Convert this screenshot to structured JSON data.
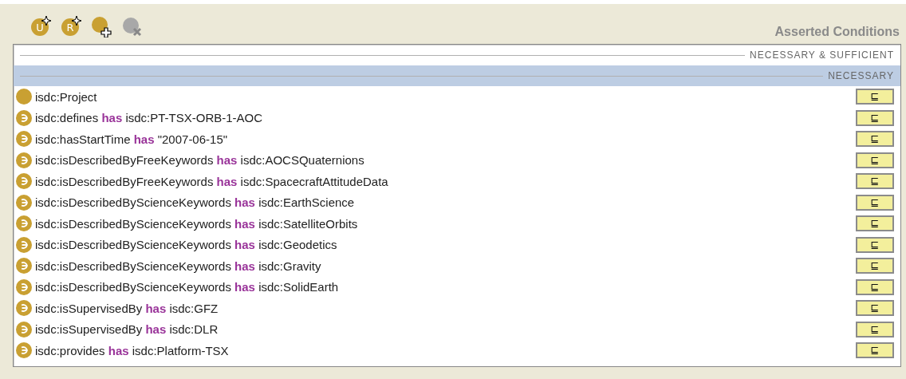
{
  "toolbar": [
    {
      "kind": "new-union",
      "letter": "U",
      "disabled": false
    },
    {
      "kind": "new-restriction",
      "letter": "R",
      "disabled": false
    },
    {
      "kind": "add-class",
      "disabled": false
    },
    {
      "kind": "remove",
      "disabled": true
    }
  ],
  "panel_title": "Asserted Conditions",
  "sections": [
    {
      "label": "NECESSARY & SUFFICIENT",
      "selected": false
    },
    {
      "label": "NECESSARY",
      "selected": true
    }
  ],
  "conditions": [
    {
      "kind": "class",
      "text": "isdc:Project",
      "button": "⊑"
    },
    {
      "kind": "restriction",
      "text": "isdc:defines **has** isdc:PT-TSX-ORB-1-AOC",
      "button": "⊑"
    },
    {
      "kind": "restriction",
      "text": "isdc:hasStartTime **has** \"2007-06-15\"",
      "button": "⊑"
    },
    {
      "kind": "restriction",
      "text": "isdc:isDescribedByFreeKeywords **has** isdc:AOCSQuaternions",
      "button": "⊑"
    },
    {
      "kind": "restriction",
      "text": "isdc:isDescribedByFreeKeywords **has** isdc:SpacecraftAttitudeData",
      "button": "⊑"
    },
    {
      "kind": "restriction",
      "text": "isdc:isDescribedByScienceKeywords **has** isdc:EarthScience",
      "button": "⊑"
    },
    {
      "kind": "restriction",
      "text": "isdc:isDescribedByScienceKeywords **has** isdc:SatelliteOrbits",
      "button": "⊑"
    },
    {
      "kind": "restriction",
      "text": "isdc:isDescribedByScienceKeywords **has** isdc:Geodetics",
      "button": "⊑"
    },
    {
      "kind": "restriction",
      "text": "isdc:isDescribedByScienceKeywords **has** isdc:Gravity",
      "button": "⊑"
    },
    {
      "kind": "restriction",
      "text": "isdc:isDescribedByScienceKeywords **has** isdc:SolidEarth",
      "button": "⊑"
    },
    {
      "kind": "restriction",
      "text": "isdc:isSupervisedBy **has** isdc:GFZ",
      "button": "⊑"
    },
    {
      "kind": "restriction",
      "text": "isdc:isSupervisedBy **has** isdc:DLR",
      "button": "⊑"
    },
    {
      "kind": "restriction",
      "text": "isdc:provides **has** isdc:Platform-TSX",
      "button": "⊑"
    }
  ]
}
